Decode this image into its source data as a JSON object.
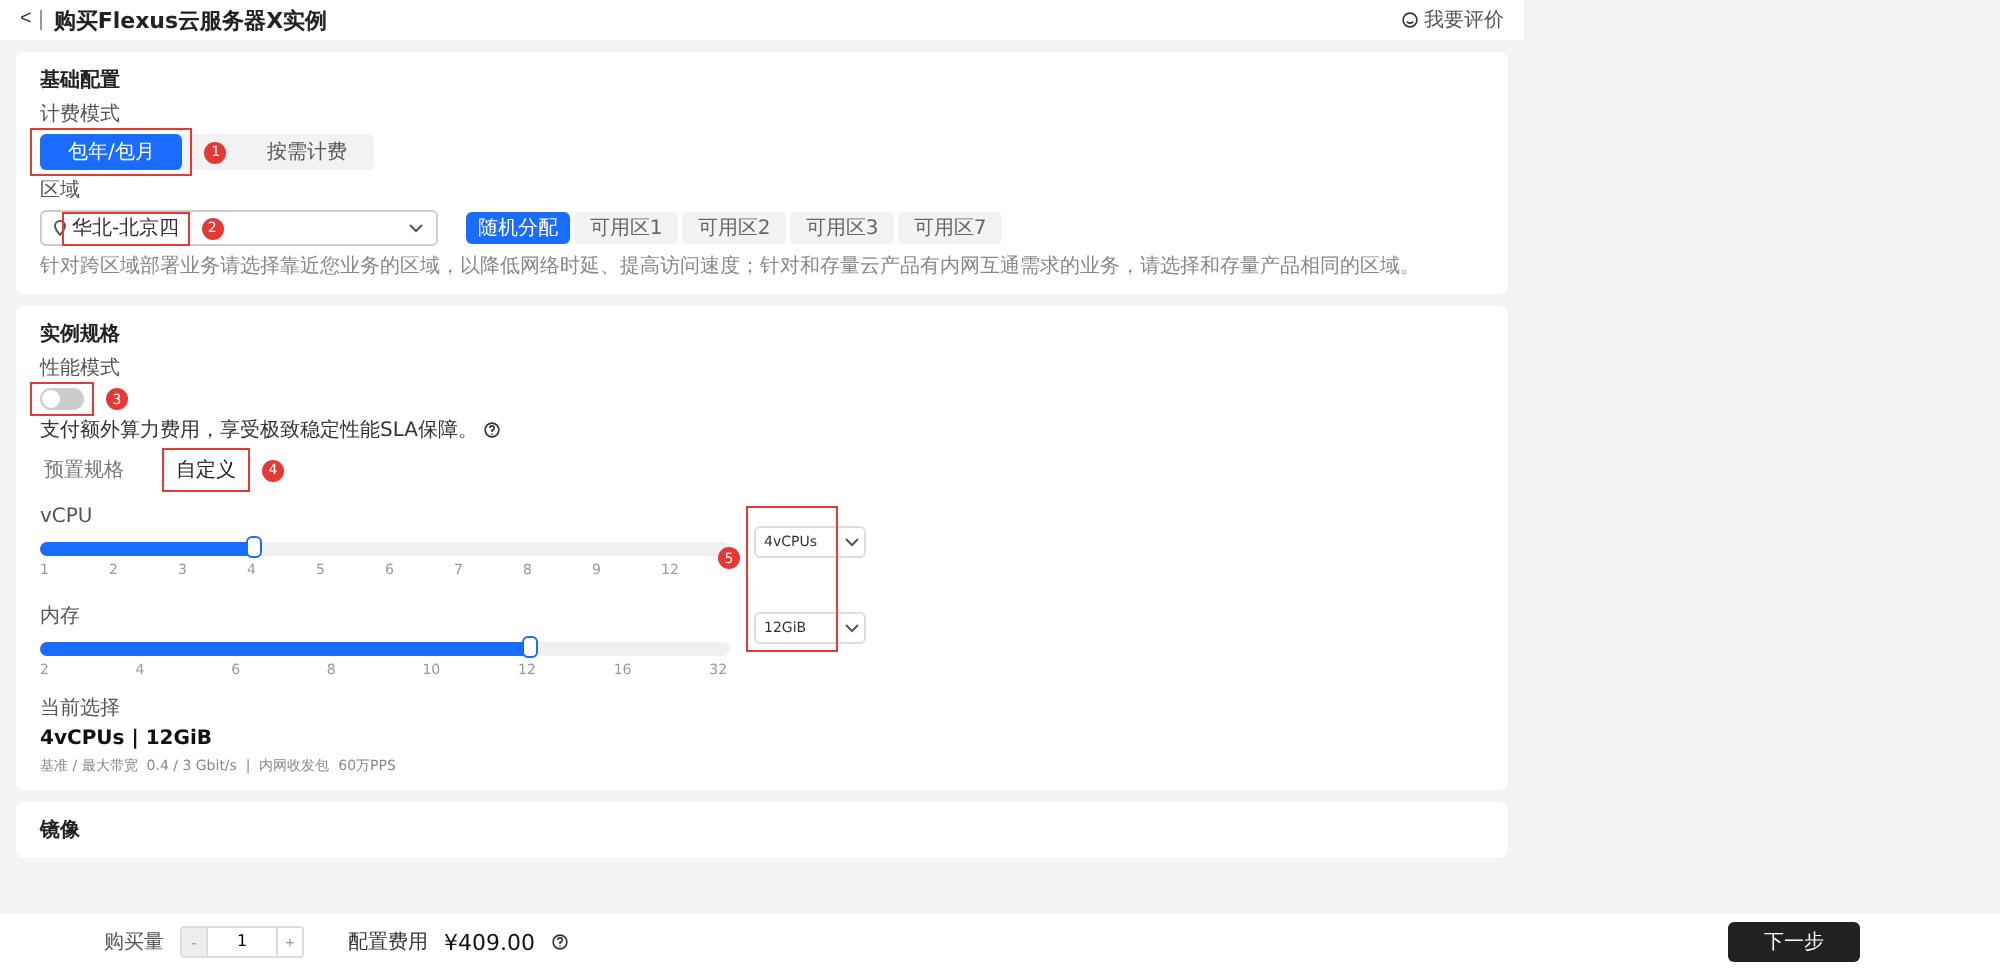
{
  "header": {
    "back": "<",
    "title": "购买Flexus云服务器X实例",
    "feedback": "我要评价"
  },
  "basic": {
    "title": "基础配置",
    "billing_label": "计费模式",
    "billing_options": [
      {
        "label": "包年/包月",
        "selected": true,
        "annotation": "1"
      },
      {
        "label": "按需计费",
        "selected": false
      }
    ],
    "region_label": "区域",
    "region": {
      "value": "华北-北京四",
      "annotation": "2"
    },
    "zones": [
      {
        "label": "随机分配",
        "selected": true
      },
      {
        "label": "可用区1",
        "selected": false
      },
      {
        "label": "可用区2",
        "selected": false
      },
      {
        "label": "可用区3",
        "selected": false
      },
      {
        "label": "可用区7",
        "selected": false
      }
    ],
    "hint": "针对跨区域部署业务请选择靠近您业务的区域，以降低网络时延、提高访问速度；针对和存量云产品有内网互通需求的业务，请选择和存量产品相同的区域。"
  },
  "spec": {
    "title": "实例规格",
    "perf_label": "性能模式",
    "perf_on": false,
    "perf_annotation": "3",
    "perf_note": "支付额外算力费用，享受极致稳定性能SLA保障。",
    "tabs": [
      {
        "label": "预置规格",
        "selected": false
      },
      {
        "label": "自定义",
        "selected": true,
        "annotation": "4"
      }
    ],
    "sliders": [
      {
        "label": "vCPU",
        "level": 0.31,
        "ticks": [
          "1",
          "2",
          "3",
          "4",
          "5",
          "6",
          "7",
          "8",
          "9",
          "12"
        ],
        "value": "4vCPUs"
      },
      {
        "label": "内存",
        "level": 0.71,
        "ticks": [
          "2",
          "4",
          "6",
          "8",
          "10",
          "12",
          "16",
          "32"
        ],
        "value": "12GiB"
      }
    ],
    "slider_annotation": "5",
    "current_label": "当前选择",
    "current_value": "4vCPUs | 12GiB",
    "current_detail": "基准 / 最大带宽  0.4 / 3 Gbit/s  |  内网收发包  60万PPS"
  },
  "image": {
    "title": "镜像"
  },
  "footer": {
    "qty_label": "购买量",
    "minus": "-",
    "qty": "1",
    "plus": "+",
    "fee_label": "配置费用",
    "fee": "¥409.00",
    "next": "下一步"
  }
}
